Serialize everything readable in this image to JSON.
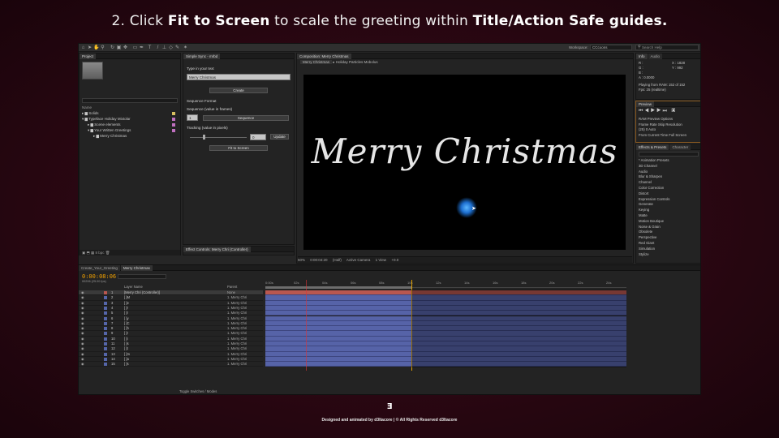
{
  "headline": {
    "prefix": "2. Click ",
    "bold1": "Fit to Screen",
    "middle": " to scale the greeting within ",
    "bold2": "Title/Action Safe guides."
  },
  "app": {
    "workspace_label": "Workspace:",
    "workspace_value": "CCcoons",
    "search_help": "Search Help",
    "project_tab": "Project",
    "project_rows": [
      {
        "name": "Name",
        "color": "#999"
      },
      {
        "name": "Solids",
        "color": "#d8c060"
      },
      {
        "name": "Typeface Holiday Mixtolar",
        "color": "#c070c0"
      },
      {
        "name": "Scene elements",
        "color": "#c070c0"
      },
      {
        "name": "Your Written Greetings",
        "color": "#c070c0"
      },
      {
        "name": "Merry Christmas",
        "color": "#c070c0"
      }
    ],
    "script_tab": "Simple Sync - mrbd",
    "script": {
      "type_label": "Type in your text",
      "text_value": "Merry Christmas",
      "create_btn": "Create",
      "sequence_format": "Sequence Format",
      "seq_value_label": "Sequence (value in frames)",
      "seq_value": "1",
      "sequence_btn": "Sequence",
      "tracking_label": "Tracking (value in pixels)",
      "tracking_value": "0",
      "update_btn": "Update",
      "fit_btn": "Fit to Screen"
    },
    "effects_tab": "Effect Controls: Merry Chri (Controller)",
    "comp_tab": "Composition: Merry Christmas",
    "comp_subtabs": [
      "Merry Christmas",
      "Holiday Particles Mobolus"
    ],
    "comp_text": "Merry Christmas",
    "comp_footer": [
      "50%",
      "0:00:04:20",
      "(Half)",
      "Active Camera",
      "1 View",
      "+0.0"
    ],
    "info_tab": "Info",
    "audio_tab": "Audio",
    "info_lines": [
      "R :",
      "G :",
      "B :",
      "A : 0.0000",
      "X : 1828",
      "Y : 992",
      "Playing from RAM: 152 of 152",
      "Fps: 25 (realtime)"
    ],
    "preview_tab": "Preview",
    "preview_lines": [
      "RAM Preview Options",
      "Frame Rate   Skip   Resolution",
      "(25)    0    Auto",
      "From Current Time    Full Screen"
    ],
    "effects_presets_tab": "Effects & Presets",
    "character_tab": "Character",
    "effects_list": [
      "* Animation Presets",
      "3D Channel",
      "Audio",
      "Blur & Sharpen",
      "Channel",
      "Color Correction",
      "Distort",
      "Expression Controls",
      "Generate",
      "Keying",
      "Matte",
      "Motion Boutique",
      "Noise & Grain",
      "Obsolete",
      "Perspective",
      "Red Giant",
      "Simulation",
      "Stylize"
    ],
    "paragraph_tab": "Paragraph",
    "align_tab": "Align",
    "align_lines": [
      "Align Layers to:",
      "Composition",
      "Distribute Layers:"
    ],
    "timeline_tabs": [
      "Create_Your_Greeting",
      "Merry Christmas"
    ],
    "timecode": "0:00:08:06",
    "timecode_sub": "00206 (25.00 fps)",
    "layer_header": {
      "name": "Layer Name",
      "parent": "Parent"
    },
    "layers": [
      {
        "n": "1",
        "name": "[Merry Chri (Controller)]",
        "parent": "None"
      },
      {
        "n": "2",
        "name": "[ ]M",
        "parent": "1. Merry Chri"
      },
      {
        "n": "3",
        "name": "[ ]e",
        "parent": "1. Merry Chri"
      },
      {
        "n": "4",
        "name": "[ ]r",
        "parent": "1. Merry Chri"
      },
      {
        "n": "5",
        "name": "[ ]r",
        "parent": "1. Merry Chri"
      },
      {
        "n": "6",
        "name": "[ ]y",
        "parent": "1. Merry Chri"
      },
      {
        "n": "7",
        "name": "[ ]C",
        "parent": "1. Merry Chri"
      },
      {
        "n": "8",
        "name": "[ ]h",
        "parent": "1. Merry Chri"
      },
      {
        "n": "9",
        "name": "[ ]r",
        "parent": "1. Merry Chri"
      },
      {
        "n": "10",
        "name": "[ ]i",
        "parent": "1. Merry Chri"
      },
      {
        "n": "11",
        "name": "[ ]s",
        "parent": "1. Merry Chri"
      },
      {
        "n": "12",
        "name": "[ ]t",
        "parent": "1. Merry Chri"
      },
      {
        "n": "13",
        "name": "[ ]m",
        "parent": "1. Merry Chri"
      },
      {
        "n": "14",
        "name": "[ ]a",
        "parent": "1. Merry Chri"
      },
      {
        "n": "15",
        "name": "[ ]s",
        "parent": "1. Merry Chri"
      }
    ],
    "ruler_ticks": [
      "0:00s",
      "02s",
      "04s",
      "06s",
      "08s",
      "10s",
      "12s",
      "14s",
      "16s",
      "18s",
      "20s",
      "22s",
      "24s"
    ],
    "toggle_label": "Toggle Switches / Modes"
  },
  "footer": {
    "logo": "Ǝ",
    "text": "Designed and animated by d3ltacore | © All Rights Reserved d3ltacore"
  }
}
